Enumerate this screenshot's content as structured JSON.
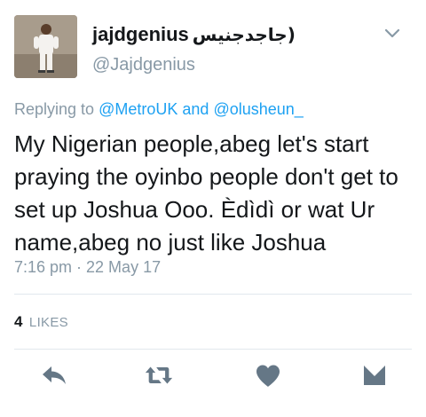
{
  "tweet": {
    "display_name": "jajdgenius",
    "display_name_arabic": "(جاجدجنيس",
    "handle": "@Jajdgenius",
    "avatar_icon": "user-avatar-photo",
    "replying_prefix": "Replying to",
    "replying_to_1": "@MetroUK",
    "replying_and": "and",
    "replying_to_2": "@olusheun_",
    "text": "My Nigerian people,abeg let's start praying the oyinbo people don't get to set up Joshua Ooo. Èdìdì or wat Ur name,abeg no just like Joshua",
    "timestamp": "7:16 pm · 22 May 17",
    "likes_count": "4",
    "likes_label": "LIKES"
  },
  "actions": {
    "reply_icon": "reply-icon",
    "retweet_icon": "retweet-icon",
    "like_icon": "heart-icon",
    "dm_icon": "envelope-icon"
  },
  "colors": {
    "link": "#1da1f2",
    "secondary_text": "#8899a6",
    "primary_text": "#14171a",
    "icon": "#657786",
    "divider": "#e1e8ed"
  }
}
